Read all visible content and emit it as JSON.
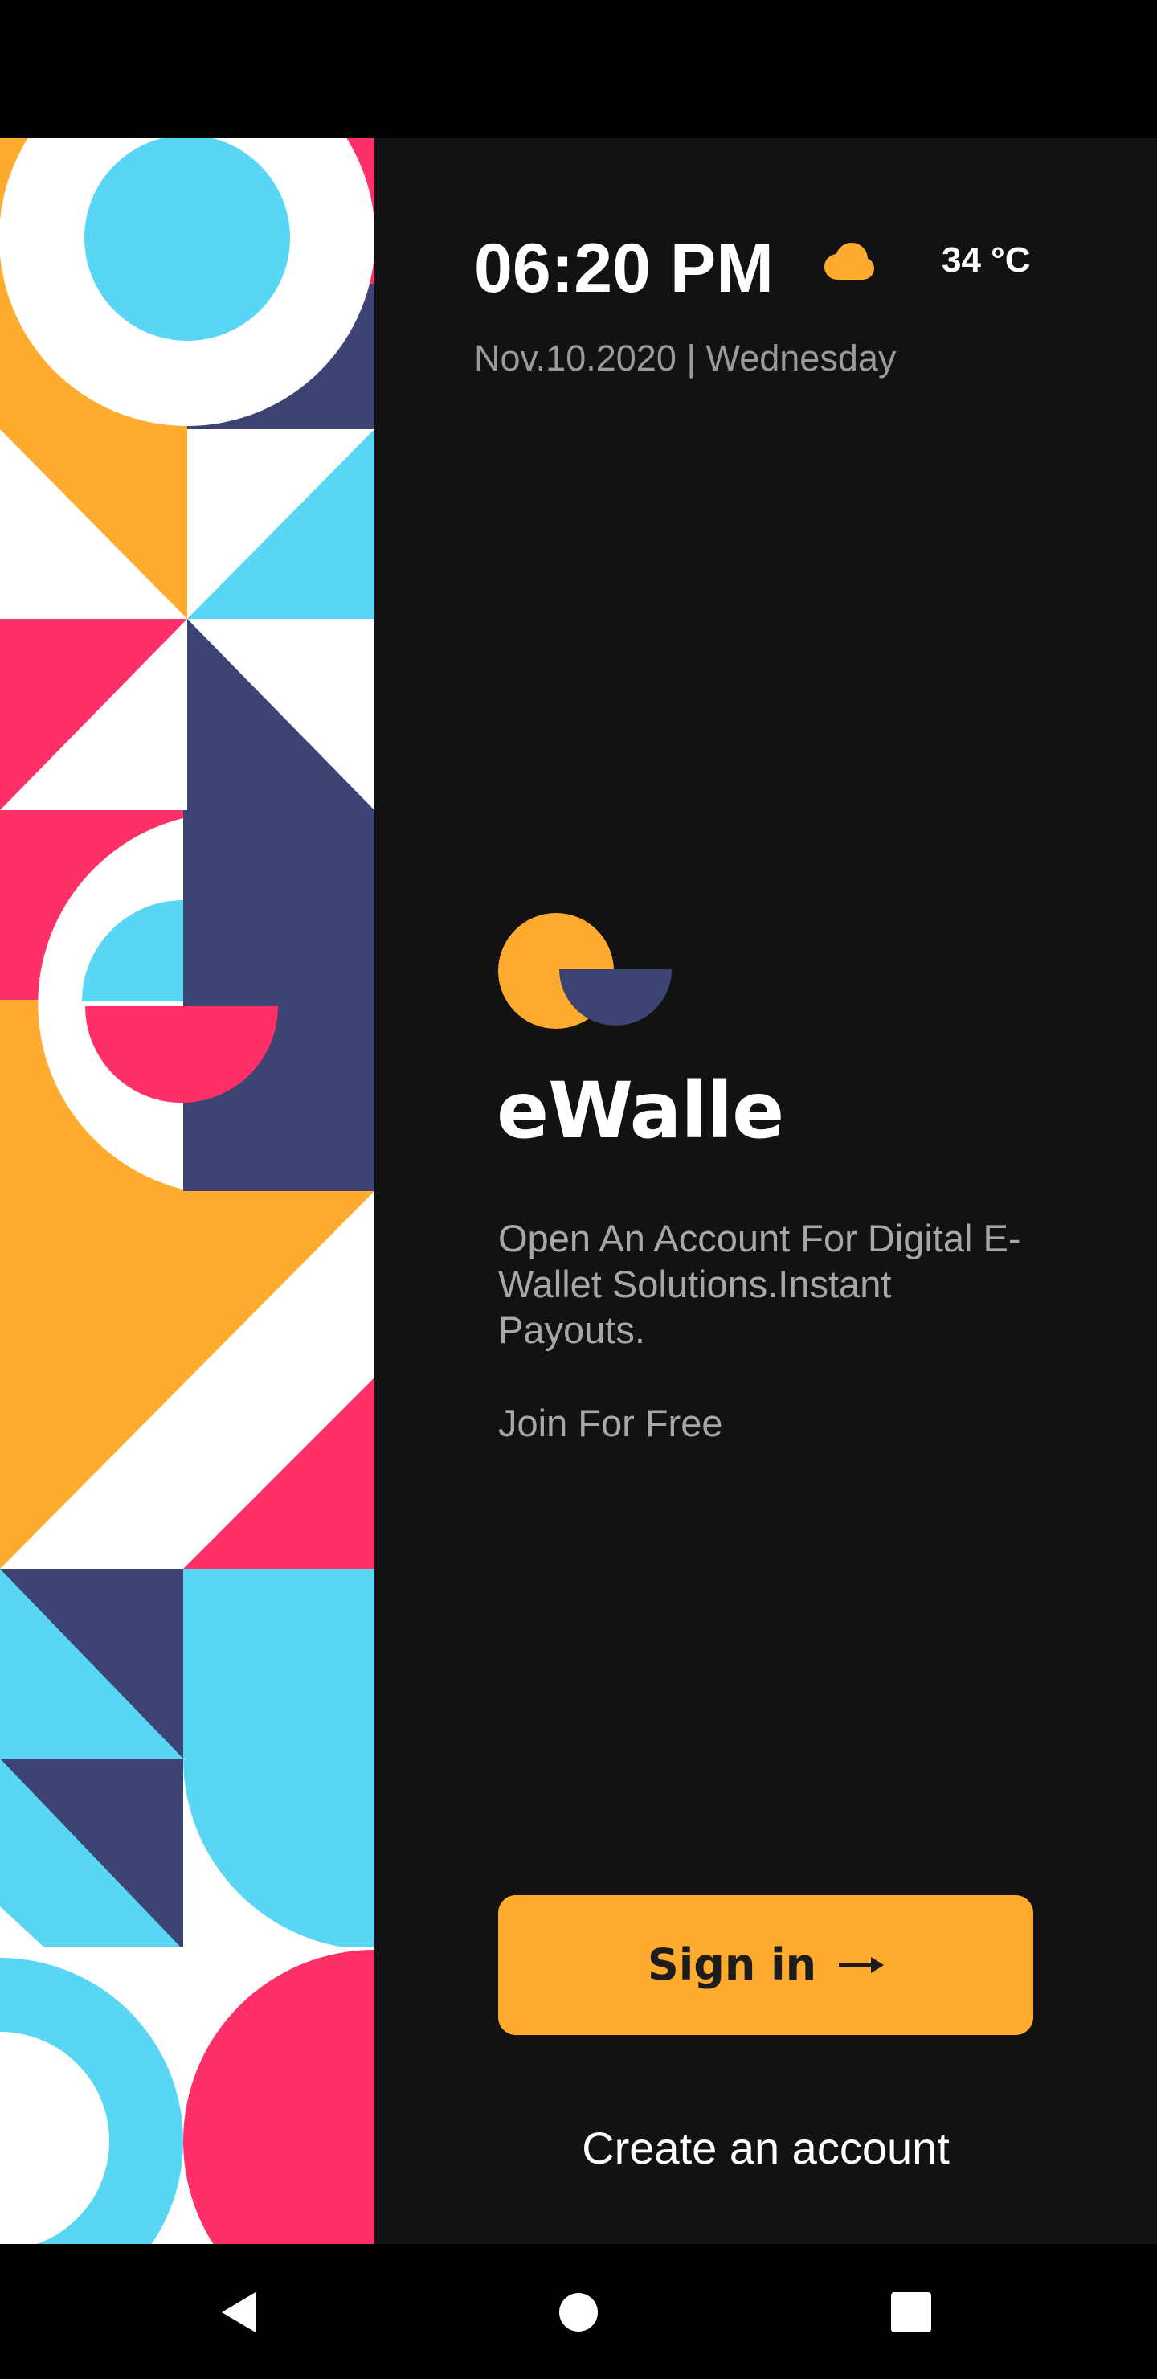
{
  "header": {
    "time": "06:20 PM",
    "weather_icon": "cloud-icon",
    "temperature": "34 °C",
    "date": "Nov.10.2020 | Wednesday"
  },
  "brand": {
    "logo_icon": "ewalle-logo-icon",
    "name": "eWalle",
    "tagline": "Open An Account For Digital E-Wallet Solutions.Instant Payouts.",
    "join_text": "Join For Free"
  },
  "actions": {
    "sign_in_label": "Sign in",
    "sign_in_icon": "arrow-right-icon",
    "create_account_label": "Create an account"
  },
  "navigation": {
    "back_icon": "back-triangle-icon",
    "home_icon": "home-circle-icon",
    "recents_icon": "recents-square-icon"
  },
  "colors": {
    "accent": "#ffab2e",
    "navy": "#3d4373",
    "pink": "#ff3068",
    "sky": "#58d7f5",
    "background": "#121212"
  }
}
